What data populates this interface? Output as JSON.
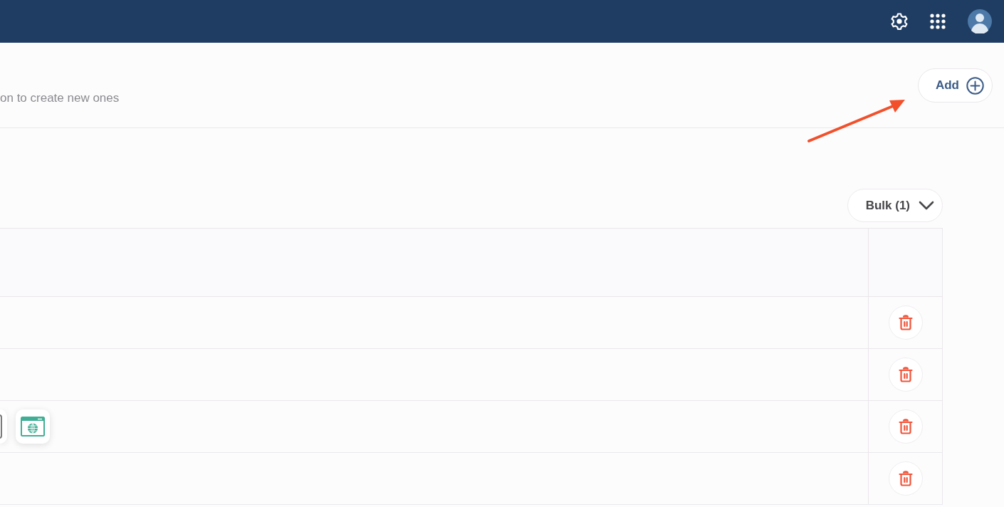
{
  "header": {
    "subtitle": "on to create new ones",
    "add_button": "Add"
  },
  "toolbar": {
    "bulk_button": "Bulk (1)"
  },
  "table": {
    "rows": [
      {
        "delete_button": true
      },
      {
        "delete_button": true
      },
      {
        "delete_button": true,
        "platforms": [
          {
            "kind": "tablet"
          },
          {
            "kind": "web"
          }
        ]
      },
      {
        "delete_button": true
      }
    ]
  }
}
